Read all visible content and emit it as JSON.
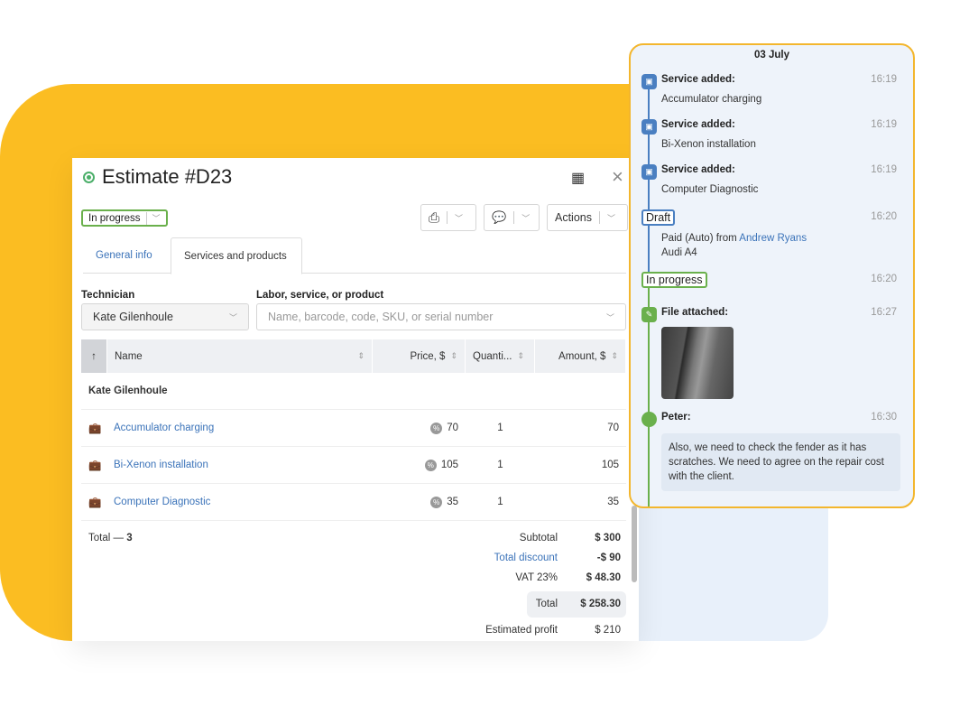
{
  "estimate": {
    "title": "Estimate #D23",
    "status": "In progress",
    "actions_label": "Actions",
    "tabs": [
      {
        "label": "General info"
      },
      {
        "label": "Services and products"
      }
    ],
    "technician_label": "Technician",
    "technician_value": "Kate Gilenhoule",
    "product_label": "Labor, service, or product",
    "product_placeholder": "Name, barcode, code, SKU, or serial number",
    "columns": [
      "Name",
      "Price, $",
      "Quanti...",
      "Amount, $"
    ],
    "group": "Kate Gilenhoule",
    "rows": [
      {
        "name": "Accumulator charging",
        "price": "70",
        "qty": "1",
        "amount": "70"
      },
      {
        "name": "Bi-Xenon installation",
        "price": "105",
        "qty": "1",
        "amount": "105"
      },
      {
        "name": "Computer Diagnostic",
        "price": "35",
        "qty": "1",
        "amount": "35"
      }
    ],
    "total_count_label": "Total — ",
    "total_count": "3",
    "totals": {
      "subtotal_label": "Subtotal",
      "subtotal": "$ 300",
      "discount_label": "Total discount",
      "discount": "-$ 90",
      "vat_label": "VAT 23%",
      "vat": "$ 48.30",
      "total_label": "Total",
      "total": "$ 258.30",
      "profit_label": "Estimated profit",
      "profit": "$ 210"
    }
  },
  "timeline": {
    "date": "03 July",
    "events": [
      {
        "title": "Service added:",
        "text": "Accumulator charging",
        "time": "16:19"
      },
      {
        "title": "Service added:",
        "text": "Bi-Xenon installation",
        "time": "16:19"
      },
      {
        "title": "Service added:",
        "text": "Computer Diagnostic",
        "time": "16:19"
      }
    ],
    "draft": {
      "label": "Draft",
      "time": "16:20",
      "text": "Paid (Auto) from ",
      "client": "Andrew Ryans",
      "vehicle": "Audi A4"
    },
    "progress": {
      "label": "In progress",
      "time": "16:20"
    },
    "file": {
      "title": "File attached:",
      "time": "16:27"
    },
    "comment": {
      "author": "Peter:",
      "time": "16:30",
      "text": "Also, we need to check the fender as it has scratches. We need to agree on the repair cost with the client."
    }
  },
  "colors": {
    "accent": "#fbbd22",
    "link": "#3b73b9",
    "green": "#6ab04c",
    "blue": "#4a7fc1"
  }
}
